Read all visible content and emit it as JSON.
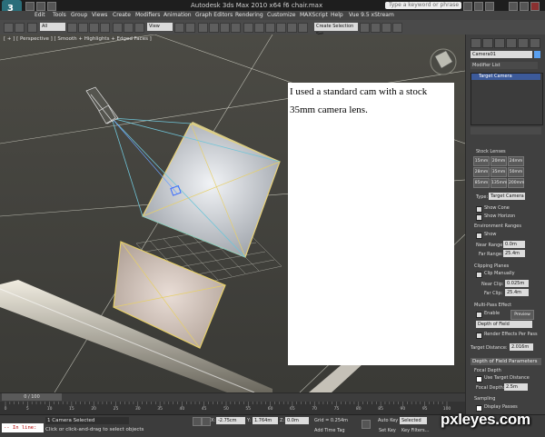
{
  "window": {
    "title": "Autodesk 3ds Max 2010 x64    f6 chair.max",
    "search_placeholder": "Type a keyword or phrase"
  },
  "menu": [
    "Edit",
    "Tools",
    "Group",
    "Views",
    "Create",
    "Modifiers",
    "Animation",
    "Graph Editors",
    "Rendering",
    "Customize",
    "MAXScript",
    "Help",
    "Vue 9.5 xStream"
  ],
  "toolbar": {
    "selection_filter": "All",
    "view_mode": "View",
    "named_selection": "Create Selection Set"
  },
  "viewport": {
    "label": "[ + ] [ Perspective ] [ Smooth + Highlights + Edged Faces ]"
  },
  "note": {
    "text": "I used a standard cam with a stock 35mm camera lens."
  },
  "panel": {
    "object_name": "Camera01",
    "modifier_list": "Modifier List",
    "stack_item": "Target Camera",
    "stock_lenses_title": "Stock Lenses",
    "lenses": [
      "15mm",
      "20mm",
      "24mm",
      "28mm",
      "35mm",
      "50mm",
      "85mm",
      "135mm",
      "200mm"
    ],
    "type_label": "Type:",
    "type_value": "Target Camera",
    "show_cone": "Show Cone",
    "show_horizon": "Show Horizon",
    "env_ranges": "Environment Ranges",
    "show": "Show",
    "near_range_label": "Near Range:",
    "near_range_value": "0.0m",
    "far_range_label": "Far Range:",
    "far_range_value": "25.4m",
    "clipping_planes": "Clipping Planes",
    "clip_manually": "Clip Manually",
    "near_clip_label": "Near Clip:",
    "near_clip_value": "0.025m",
    "far_clip_label": "Far Clip:",
    "far_clip_value": "25.4m",
    "multipass": "Multi-Pass Effect",
    "enable": "Enable",
    "preview": "Preview",
    "effect_value": "Depth of Field",
    "render_effects": "Render Effects Per Pass",
    "target_distance_label": "Target Distance:",
    "target_distance_value": "2.016m",
    "dof_params": "Depth of Field Parameters",
    "focal_depth_group": "Focal Depth",
    "use_target_distance": "Use Target Distance",
    "focal_depth_label": "Focal Depth:",
    "focal_depth_value": "2.5m",
    "sampling": "Sampling",
    "display_passes": "Display Passes"
  },
  "timeline": {
    "frame": "0 / 100",
    "ticks": [
      "0",
      "5",
      "10",
      "15",
      "20",
      "25",
      "30",
      "35",
      "40",
      "45",
      "50",
      "55",
      "60",
      "65",
      "70",
      "75",
      "80",
      "85",
      "90",
      "95",
      "100"
    ]
  },
  "status": {
    "inline": "-- In line:",
    "selected": "1 Camera Selected",
    "prompt": "Click or click-and-drag to select objects",
    "x_label": "X:",
    "x_value": "-2.75cm",
    "y_label": "Y:",
    "y_value": "1.764m",
    "z_label": "Z:",
    "z_value": "0.0m",
    "grid": "Grid = 0.254m",
    "add_time_tag": "Add Time Tag",
    "auto_key": "Auto Key",
    "set_key": "Set Key",
    "selected_filter": "Selected",
    "key_filters": "Key Filters..."
  },
  "watermark": "pxleyes.com"
}
